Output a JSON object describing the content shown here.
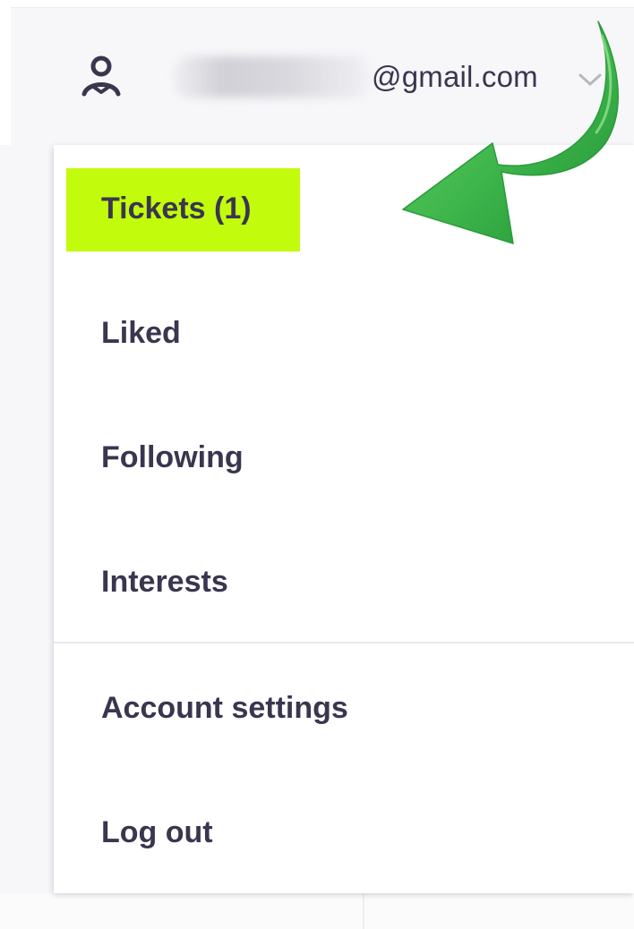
{
  "header": {
    "email_suffix": "@gmail.com",
    "icons": {
      "user": "user-icon",
      "chevron": "chevron-down-icon"
    }
  },
  "menu": {
    "items": [
      {
        "label": "Tickets (1)",
        "highlighted": true
      },
      {
        "label": "Liked"
      },
      {
        "label": "Following"
      },
      {
        "label": "Interests"
      },
      {
        "label": "Account settings"
      },
      {
        "label": "Log out"
      }
    ]
  },
  "annotation": {
    "arrow_icon": "curved-arrow-icon",
    "arrow_color": "#3db54a"
  },
  "colors": {
    "highlight": "#c2fb0b",
    "text": "#39364f",
    "header_bg": "#f7f7fa"
  }
}
